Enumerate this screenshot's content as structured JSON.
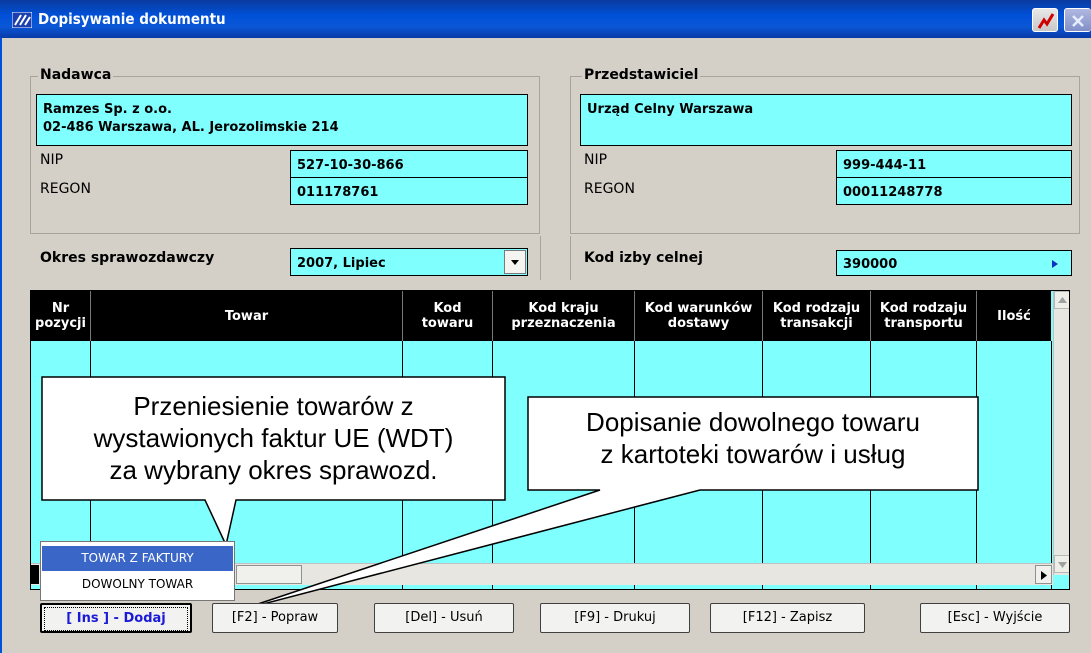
{
  "window": {
    "title": "Dopisywanie dokumentu"
  },
  "sender": {
    "legend": "Nadawca",
    "address_line1": "Ramzes Sp. z o.o.",
    "address_line2": "02-486 Warszawa, AL. Jerozolimskie 214",
    "nip_label": "NIP",
    "nip_value": "527-10-30-866",
    "regon_label": "REGON",
    "regon_value": "011178761"
  },
  "representative": {
    "legend": "Przedstawiciel",
    "address_line1": "Urząd Celny Warszawa",
    "nip_label": "NIP",
    "nip_value": "999-444-11",
    "regon_label": "REGON",
    "regon_value": "00011248778"
  },
  "period": {
    "label": "Okres sprawozdawczy",
    "value": "2007, Lipiec"
  },
  "customs": {
    "label": "Kod izby celnej",
    "value": "390000"
  },
  "grid": {
    "columns": [
      [
        "Nr",
        "pozycji"
      ],
      [
        "Towar"
      ],
      [
        "Kod",
        "towaru"
      ],
      [
        "Kod kraju",
        "przeznaczenia"
      ],
      [
        "Kod warunków",
        "dostawy"
      ],
      [
        "Kod rodzaju",
        "transakcji"
      ],
      [
        "Kod rodzaju",
        "transportu"
      ],
      [
        "Ilość"
      ]
    ]
  },
  "callouts": {
    "left": [
      "Przeniesienie towarów z",
      "wystawionych faktur UE (WDT)",
      "za wybrany okres sprawozd."
    ],
    "right": [
      "Dopisanie dowolnego towaru",
      "z kartoteki towarów i usług"
    ]
  },
  "menu": {
    "items": [
      "TOWAR Z FAKTURY",
      "DOWOLNY TOWAR"
    ]
  },
  "buttons": {
    "add": "[ Ins ] - Dodaj",
    "edit": "[F2] - Popraw",
    "delete": "[Del] - Usuń",
    "print": "[F9] - Drukuj",
    "save": "[F12] - Zapisz",
    "exit": "[Esc] - Wyjście"
  },
  "colors": {
    "field": "#80ffff",
    "titlebar": "#0050d8",
    "menu_highlight": "#3a66c8"
  }
}
